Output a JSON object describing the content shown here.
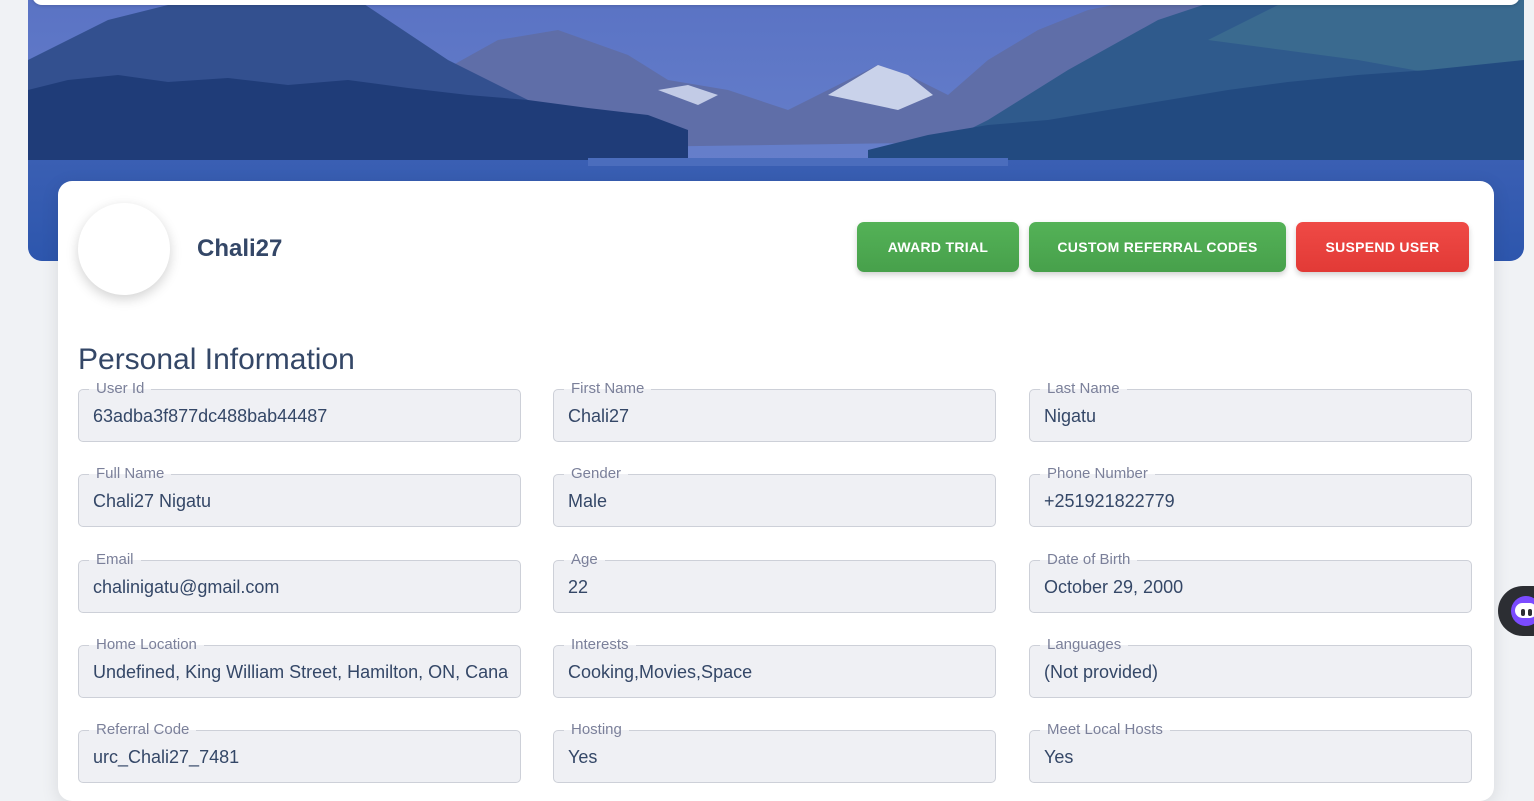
{
  "profile": {
    "username": "Chali27"
  },
  "actions": {
    "award_trial": "AWARD TRIAL",
    "custom_referral_codes": "CUSTOM REFERRAL CODES",
    "suspend_user": "SUSPEND USER"
  },
  "section": {
    "title": "Personal Information"
  },
  "fields": {
    "user_id": {
      "label": "User Id",
      "value": "63adba3f877dc488bab44487"
    },
    "first_name": {
      "label": "First Name",
      "value": "Chali27"
    },
    "last_name": {
      "label": "Last Name",
      "value": "Nigatu"
    },
    "full_name": {
      "label": "Full Name",
      "value": "Chali27 Nigatu"
    },
    "gender": {
      "label": "Gender",
      "value": "Male"
    },
    "phone": {
      "label": "Phone Number",
      "value": "+251921822779"
    },
    "email": {
      "label": "Email",
      "value": "chalinigatu@gmail.com"
    },
    "age": {
      "label": "Age",
      "value": "22"
    },
    "dob": {
      "label": "Date of Birth",
      "value": "October 29, 2000"
    },
    "home_location": {
      "label": "Home Location",
      "value": "Undefined, King William Street, Hamilton, ON, Canada"
    },
    "interests": {
      "label": "Interests",
      "value": "Cooking,Movies,Space"
    },
    "languages": {
      "label": "Languages",
      "value": "(Not provided)"
    },
    "referral_code": {
      "label": "Referral Code",
      "value": "urc_Chali27_7481"
    },
    "hosting": {
      "label": "Hosting",
      "value": "Yes"
    },
    "meet_local_hosts": {
      "label": "Meet Local Hosts",
      "value": "Yes"
    }
  },
  "colors": {
    "primary_text": "#344767",
    "success": "#4caf50",
    "danger": "#e53935",
    "hero_overlay": "#3b5fb0"
  }
}
